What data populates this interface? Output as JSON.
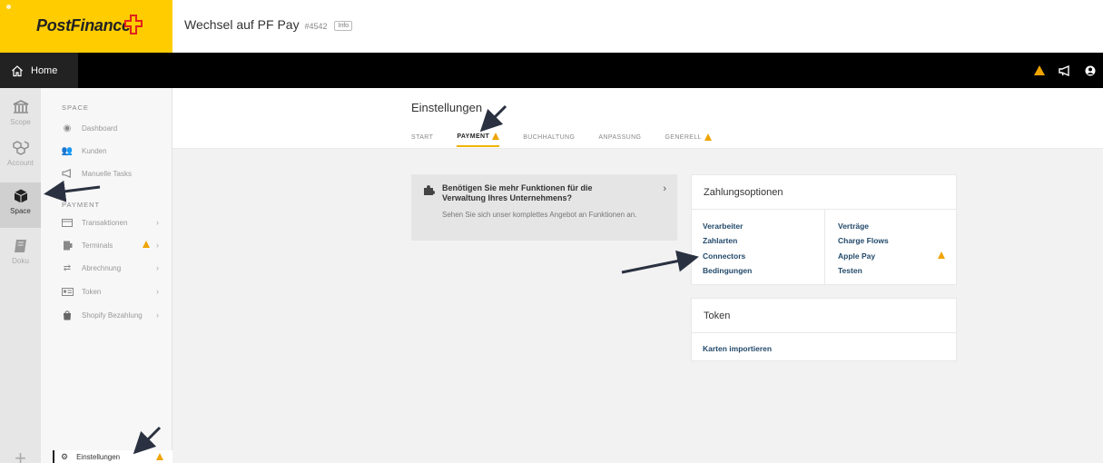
{
  "header": {
    "logo_text": "PostFinance",
    "title": "Wechsel auf PF Pay",
    "id_badge": "#4542",
    "info_label": "Info"
  },
  "nav": {
    "home_label": "Home"
  },
  "rail": {
    "items": [
      {
        "label": "Scope",
        "icon": "bank-icon"
      },
      {
        "label": "Account",
        "icon": "cubes-icon"
      },
      {
        "label": "Space",
        "icon": "cube-icon"
      },
      {
        "label": "Doku",
        "icon": "book-icon"
      }
    ]
  },
  "sidebar": {
    "space_heading": "SPACE",
    "space_items": [
      {
        "label": "Dashboard",
        "icon": "dashboard-icon"
      },
      {
        "label": "Kunden",
        "icon": "users-icon"
      },
      {
        "label": "Manuelle Tasks",
        "icon": "megaphone-icon"
      }
    ],
    "payment_heading": "PAYMENT",
    "payment_items": [
      {
        "label": "Transaktionen",
        "icon": "card-icon"
      },
      {
        "label": "Terminals",
        "icon": "terminal-icon"
      },
      {
        "label": "Abrechnung",
        "icon": "exchange-icon"
      },
      {
        "label": "Token",
        "icon": "token-icon"
      },
      {
        "label": "Shopify Bezahlung",
        "icon": "bag-icon"
      }
    ],
    "bottom_label": "Einstellungen"
  },
  "content": {
    "page_title": "Einstellungen",
    "tabs": [
      "START",
      "PAYMENT",
      "BUCHHALTUNG",
      "ANPASSUNG",
      "GENERELL"
    ]
  },
  "promo": {
    "heading": "Benötigen Sie mehr Funktionen für die Verwaltung Ihres Unternehmens?",
    "text": "Sehen Sie sich unser komplettes Angebot an Funktionen an."
  },
  "zahlungsoptionen": {
    "title": "Zahlungsoptionen",
    "left_links": [
      "Verarbeiter",
      "Zahlarten",
      "Connectors",
      "Bedingungen"
    ],
    "right_links": [
      "Verträge",
      "Charge Flows",
      "Apple Pay",
      "Testen"
    ]
  },
  "token_card": {
    "title": "Token",
    "link": "Karten importieren"
  },
  "colors": {
    "brand_yellow": "#ffcc00",
    "warning": "#f0a400",
    "link": "#234a6b"
  }
}
